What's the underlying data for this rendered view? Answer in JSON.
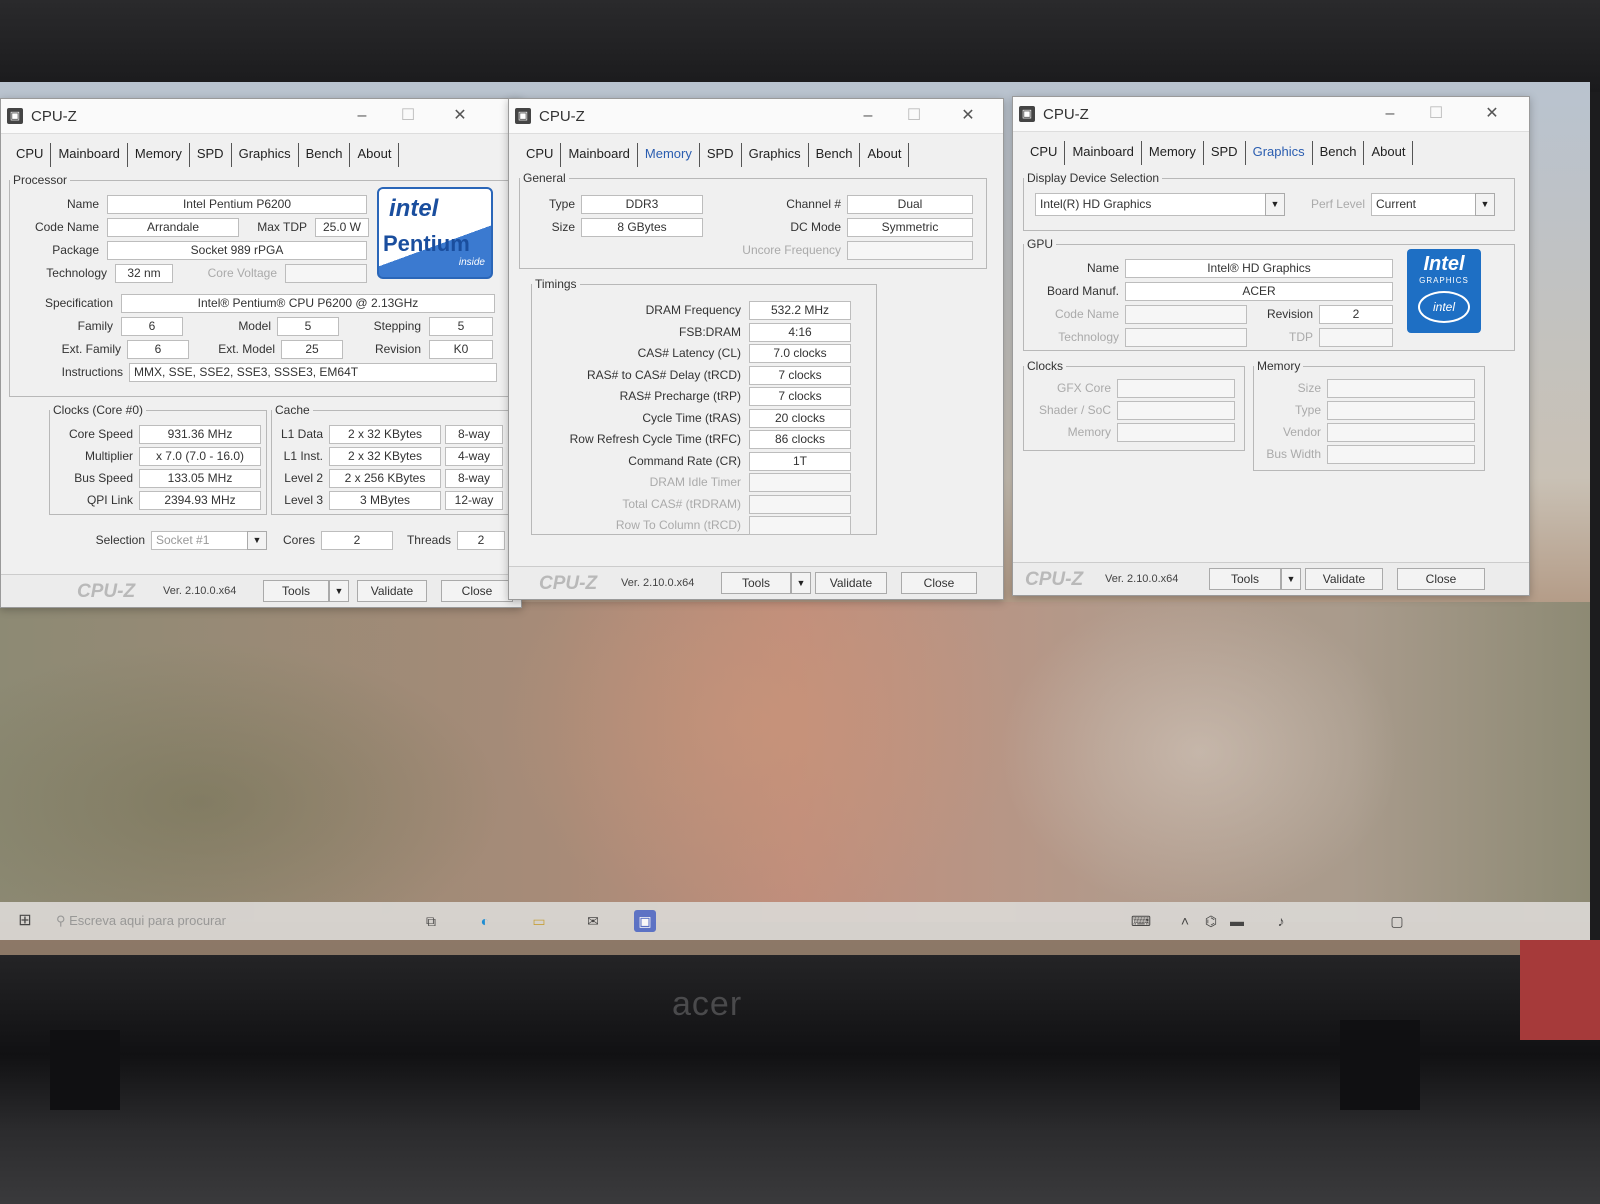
{
  "laptop": {
    "brand": "acer"
  },
  "taskbar": {
    "search_placeholder": "Escreva aqui para procurar",
    "start_icon": "windows-start-icon",
    "icons": [
      "task-view-icon",
      "edge-icon",
      "file-explorer-icon",
      "mail-icon",
      "cpuz-taskbar-icon"
    ],
    "tray": [
      "keyboard-icon",
      "chevron-up-icon",
      "network-icon",
      "battery-icon",
      "volume-icon"
    ]
  },
  "tabs": [
    "CPU",
    "Mainboard",
    "Memory",
    "SPD",
    "Graphics",
    "Bench",
    "About"
  ],
  "common": {
    "title": "CPU-Z",
    "logo": "CPU-Z",
    "version": "Ver. 2.10.0.x64",
    "tools": "Tools",
    "validate": "Validate",
    "close": "Close"
  },
  "cpu": {
    "processor_legend": "Processor",
    "labels": {
      "name": "Name",
      "code_name": "Code Name",
      "max_tdp": "Max TDP",
      "package": "Package",
      "technology": "Technology",
      "core_voltage": "Core Voltage",
      "specification": "Specification",
      "family": "Family",
      "model": "Model",
      "stepping": "Stepping",
      "ext_family": "Ext. Family",
      "ext_model": "Ext. Model",
      "revision": "Revision",
      "instructions": "Instructions"
    },
    "values": {
      "name": "Intel Pentium P6200",
      "code_name": "Arrandale",
      "max_tdp": "25.0 W",
      "package": "Socket 989 rPGA",
      "technology": "32 nm",
      "specification": "Intel® Pentium® CPU        P6200  @ 2.13GHz",
      "family": "6",
      "model": "5",
      "stepping": "5",
      "ext_family": "6",
      "ext_model": "25",
      "revision": "K0",
      "instructions": "MMX, SSE, SSE2, SSE3, SSSE3, EM64T"
    },
    "logo": {
      "brand": "intel",
      "product": "Pentium",
      "tagline": "inside"
    },
    "clocks_legend": "Clocks (Core #0)",
    "clocks": [
      {
        "label": "Core Speed",
        "value": "931.36 MHz"
      },
      {
        "label": "Multiplier",
        "value": "x 7.0 (7.0 - 16.0)"
      },
      {
        "label": "Bus Speed",
        "value": "133.05 MHz"
      },
      {
        "label": "QPI Link",
        "value": "2394.93 MHz"
      }
    ],
    "cache_legend": "Cache",
    "cache": [
      {
        "label": "L1 Data",
        "size": "2 x 32 KBytes",
        "way": "8-way"
      },
      {
        "label": "L1 Inst.",
        "size": "2 x 32 KBytes",
        "way": "4-way"
      },
      {
        "label": "Level 2",
        "size": "2 x 256 KBytes",
        "way": "8-way"
      },
      {
        "label": "Level 3",
        "size": "3 MBytes",
        "way": "12-way"
      }
    ],
    "selection_label": "Selection",
    "selection_value": "Socket #1",
    "cores_label": "Cores",
    "cores_value": "2",
    "threads_label": "Threads",
    "threads_value": "2"
  },
  "memory": {
    "general_legend": "General",
    "type_label": "Type",
    "type_value": "DDR3",
    "size_label": "Size",
    "size_value": "8 GBytes",
    "channel_label": "Channel #",
    "channel_value": "Dual",
    "dcmode_label": "DC Mode",
    "dcmode_value": "Symmetric",
    "uncore_label": "Uncore Frequency",
    "timings_legend": "Timings",
    "timings": [
      {
        "label": "DRAM Frequency",
        "value": "532.2 MHz",
        "dim": false
      },
      {
        "label": "FSB:DRAM",
        "value": "4:16",
        "dim": false
      },
      {
        "label": "CAS# Latency (CL)",
        "value": "7.0 clocks",
        "dim": false
      },
      {
        "label": "RAS# to CAS# Delay (tRCD)",
        "value": "7 clocks",
        "dim": false
      },
      {
        "label": "RAS# Precharge (tRP)",
        "value": "7 clocks",
        "dim": false
      },
      {
        "label": "Cycle Time (tRAS)",
        "value": "20 clocks",
        "dim": false
      },
      {
        "label": "Row Refresh Cycle Time (tRFC)",
        "value": "86 clocks",
        "dim": false
      },
      {
        "label": "Command Rate (CR)",
        "value": "1T",
        "dim": false
      },
      {
        "label": "DRAM Idle Timer",
        "value": "",
        "dim": true
      },
      {
        "label": "Total CAS# (tRDRAM)",
        "value": "",
        "dim": true
      },
      {
        "label": "Row To Column (tRCD)",
        "value": "",
        "dim": true
      }
    ]
  },
  "graphics": {
    "display_legend": "Display Device Selection",
    "device_value": "Intel(R) HD Graphics",
    "perf_label": "Perf Level",
    "perf_value": "Current",
    "gpu_legend": "GPU",
    "name_label": "Name",
    "name_value": "Intel® HD Graphics",
    "board_label": "Board Manuf.",
    "board_value": "ACER",
    "codename_label": "Code Name",
    "revision_label": "Revision",
    "revision_value": "2",
    "technology_label": "Technology",
    "tdp_label": "TDP",
    "logo": {
      "brand": "Intel",
      "sub": "GRAPHICS",
      "badge": "intel"
    },
    "clocks_legend": "Clocks",
    "clocks_labels": [
      "GFX Core",
      "Shader / SoC",
      "Memory"
    ],
    "memory_legend": "Memory",
    "memory_labels": [
      "Size",
      "Type",
      "Vendor",
      "Bus Width"
    ]
  },
  "colors": {
    "active_tab": "#2a5db0",
    "intel_blue": "#1e6fc4"
  }
}
